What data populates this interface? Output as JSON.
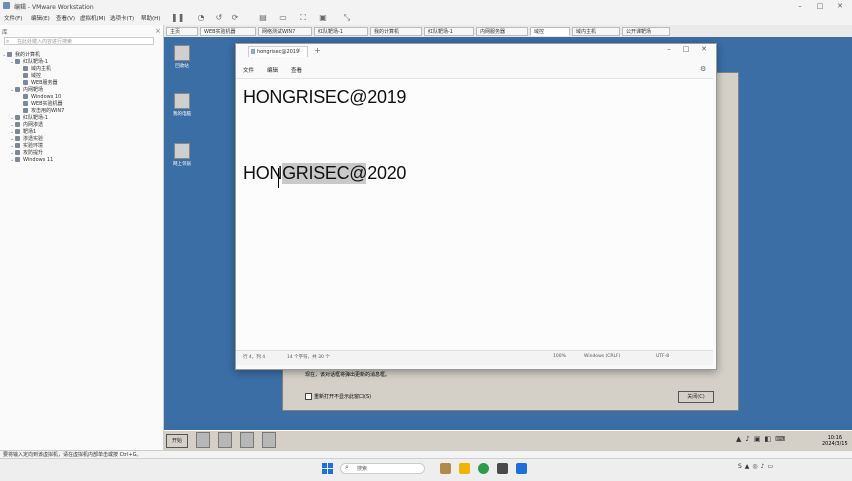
{
  "app": {
    "title": "编辑 - VMware Workstation"
  },
  "menubar": [
    "文件(F)",
    "编辑(E)",
    "查看(V)",
    "虚拟机(M)",
    "选项卡(T)",
    "帮助(H)"
  ],
  "library": {
    "header": "库",
    "search_placeholder": "在此处键入内容进行搜索",
    "tree": [
      {
        "label": "我的计算机",
        "level": 0
      },
      {
        "label": "红队靶场-1",
        "level": 1
      },
      {
        "label": "域内主机",
        "level": 2
      },
      {
        "label": "域控",
        "level": 2
      },
      {
        "label": "WEB服务器",
        "level": 2
      },
      {
        "label": "内网靶场",
        "level": 1
      },
      {
        "label": "Windows 10",
        "level": 2
      },
      {
        "label": "WEB实验机器",
        "level": 2
      },
      {
        "label": "攻击用的WIN7",
        "level": 2
      },
      {
        "label": "红队靶场-1",
        "level": 1
      },
      {
        "label": "内网渗透",
        "level": 1
      },
      {
        "label": "靶场1",
        "level": 1
      },
      {
        "label": "渗透实验",
        "level": 1
      },
      {
        "label": "实验环境",
        "level": 1
      },
      {
        "label": "攻防提升",
        "level": 1
      },
      {
        "label": "Windows 11",
        "level": 1
      }
    ]
  },
  "tabs": [
    "主页",
    "WEB实验机器",
    "网络测试WIN7",
    "红队靶场-1",
    "我的计算机",
    "红队靶场-1",
    "内网服务器",
    "域控",
    "域内主机",
    "公开课靶场"
  ],
  "desktop_icons": [
    "回收站",
    "我的电脑",
    "网上邻居"
  ],
  "dialog": {
    "message": "现在，该对话框将弹出更新的消息框。",
    "checkbox_label": "重新打开不显示此窗口(S)",
    "button": "关闭(C)"
  },
  "guest_taskbar": {
    "start": "开始",
    "clock": [
      "10:16",
      "2024/3/15"
    ]
  },
  "notepad": {
    "tab_title": "hongrisec@2019",
    "menu": [
      "文件",
      "编辑",
      "查看"
    ],
    "lines": [
      "HONGRISEC@2019",
      "",
      "",
      "HONGRISEC@2020"
    ],
    "status": {
      "position": "行 4，列 4",
      "chars": "14 个字符，共 30 个",
      "zoom": "100%",
      "line_ending": "Windows (CRLF)",
      "encoding": "UTF-8"
    }
  },
  "statusbar": {
    "text": "要将输入定向到该虚拟机，请在虚拟机内部单击或按 Ctrl+G。"
  },
  "host_taskbar": {
    "search": "搜索"
  },
  "colors": {
    "guest_desktop": "#3a6ea5",
    "host_accent": "#1e6fd9"
  }
}
